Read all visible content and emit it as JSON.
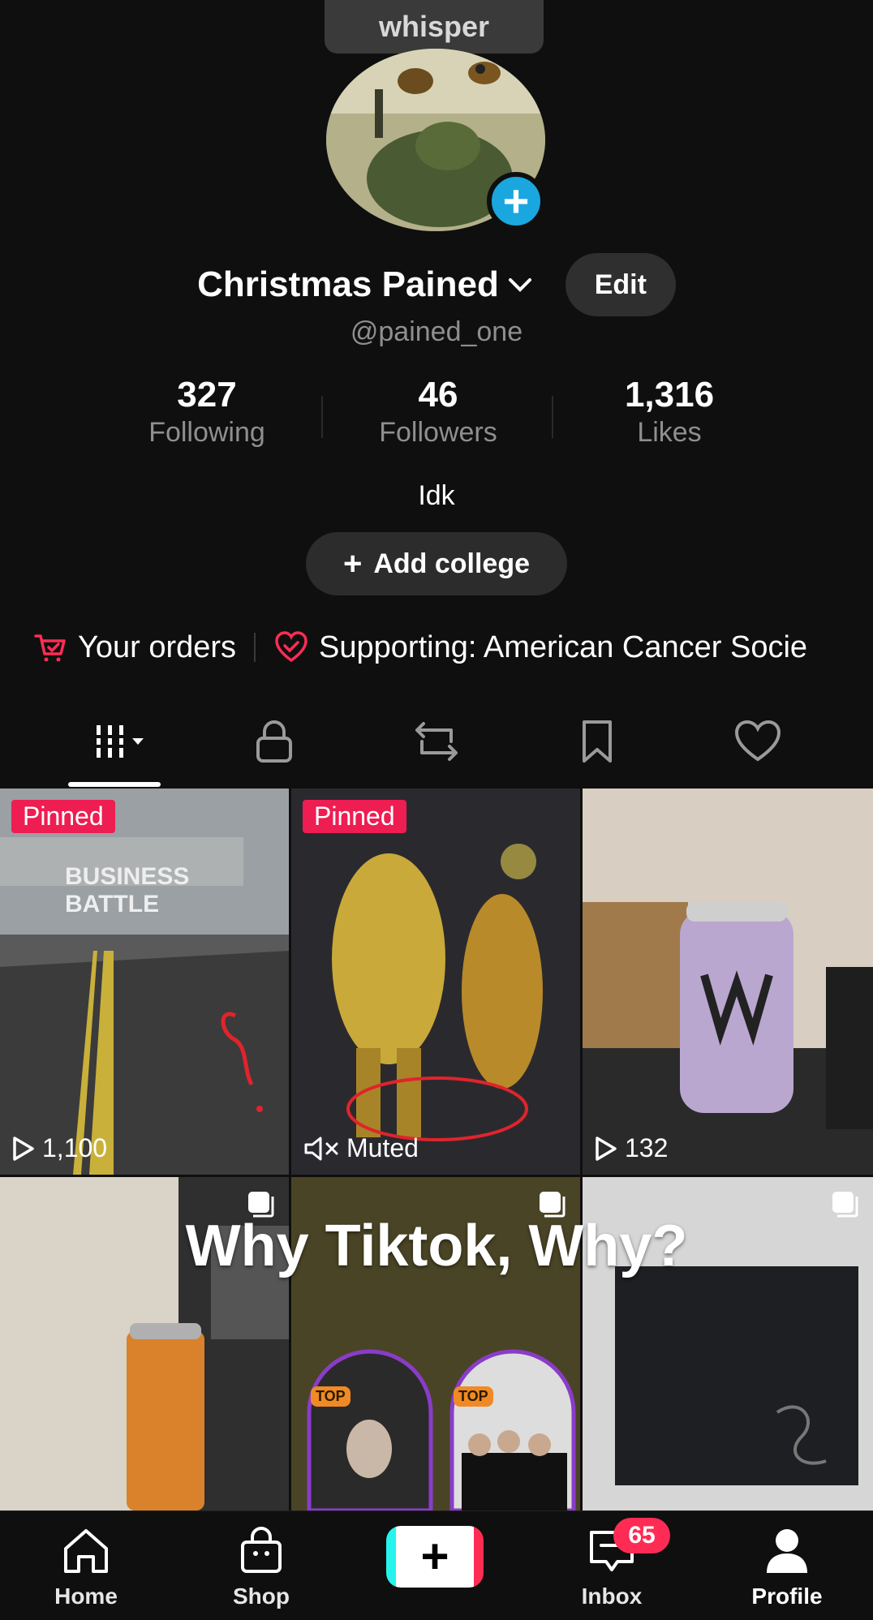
{
  "whisper": "whisper",
  "profile": {
    "display_name": "Christmas Pained",
    "username": "@pained_one",
    "edit_label": "Edit",
    "bio": "Idk",
    "add_college": "Add college"
  },
  "stats": [
    {
      "value": "327",
      "label": "Following"
    },
    {
      "value": "46",
      "label": "Followers"
    },
    {
      "value": "1,316",
      "label": "Likes"
    }
  ],
  "links": {
    "orders": "Your orders",
    "supporting": "Supporting: American Cancer Socie"
  },
  "tabs": [
    "videos-grid-icon",
    "lock-icon",
    "repost-icon",
    "bookmark-icon",
    "heart-icon"
  ],
  "videos": [
    {
      "badge": "Pinned",
      "views": "1,100",
      "overlay": "BUSINESS BATTLE"
    },
    {
      "badge": "Pinned",
      "muted": "Muted"
    },
    {
      "views": "132"
    },
    {},
    {},
    {}
  ],
  "overlay_caption": "Why Tiktok, Why?",
  "top_badge": "TOP",
  "nav": {
    "home": "Home",
    "shop": "Shop",
    "inbox": "Inbox",
    "inbox_count": "65",
    "profile": "Profile"
  },
  "colors": {
    "accent": "#fe2c55",
    "plus": "#1aa7e0",
    "teal": "#25f4ee"
  }
}
